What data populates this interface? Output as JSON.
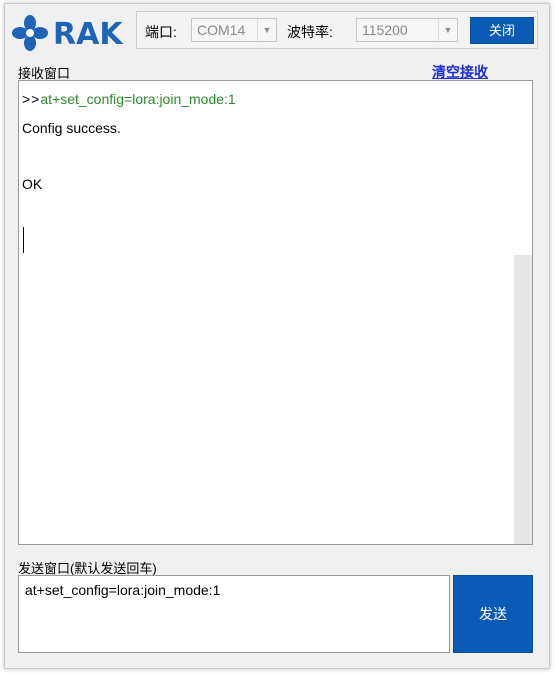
{
  "brand": {
    "name": "RAK",
    "color": "#1e63b4"
  },
  "toolbar": {
    "port_label": "端口:",
    "port_value": "COM14",
    "baud_label": "波特率:",
    "baud_value": "115200",
    "close_label": "关闭"
  },
  "receive": {
    "title": "接收窗口",
    "clear_label": "清空接收",
    "lines": [
      {
        "prompt": ">>",
        "text": "at+set_config=lora:join_mode:1"
      },
      {
        "text": "Config success."
      },
      {
        "text": "OK"
      }
    ]
  },
  "send": {
    "title": "发送窗口(默认发送回车)",
    "value": "at+set_config=lora:join_mode:1",
    "send_label": "发送"
  },
  "colors": {
    "accent": "#0a5bb5",
    "command": "#2a8a2a",
    "link": "#1f2fd8"
  }
}
